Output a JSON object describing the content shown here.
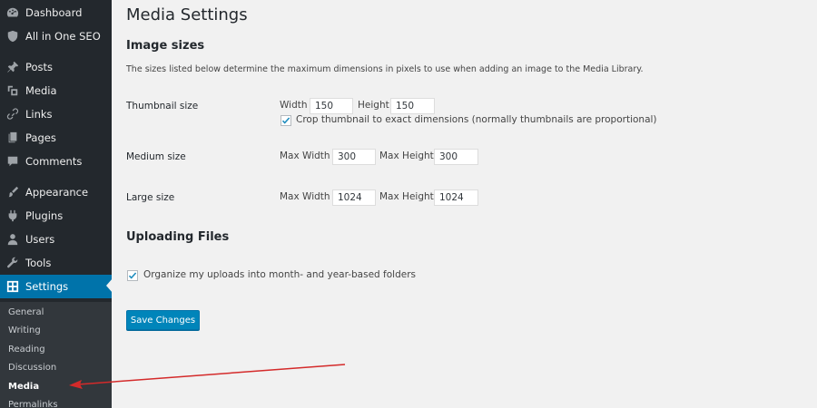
{
  "sidebar": {
    "menu": [
      {
        "label": "Dashboard",
        "icon": "dashboard-icon"
      },
      {
        "label": "All in One SEO",
        "icon": "shield-icon"
      },
      {
        "label": "Posts",
        "icon": "pushpin-icon"
      },
      {
        "label": "Media",
        "icon": "media-icon"
      },
      {
        "label": "Links",
        "icon": "link-icon"
      },
      {
        "label": "Pages",
        "icon": "pages-icon"
      },
      {
        "label": "Comments",
        "icon": "comment-icon"
      },
      {
        "label": "Appearance",
        "icon": "paintbrush-icon"
      },
      {
        "label": "Plugins",
        "icon": "plugin-icon"
      },
      {
        "label": "Users",
        "icon": "user-icon"
      },
      {
        "label": "Tools",
        "icon": "wrench-icon"
      },
      {
        "label": "Settings",
        "icon": "settings-icon"
      }
    ],
    "submenu": [
      "General",
      "Writing",
      "Reading",
      "Discussion",
      "Media",
      "Permalinks"
    ]
  },
  "main": {
    "title": "Media Settings",
    "image_sizes": {
      "heading": "Image sizes",
      "description": "The sizes listed below determine the maximum dimensions in pixels to use when adding an image to the Media Library.",
      "thumbnail": {
        "label": "Thumbnail size",
        "width_label": "Width",
        "width_value": "150",
        "height_label": "Height",
        "height_value": "150",
        "crop_label": "Crop thumbnail to exact dimensions (normally thumbnails are proportional)",
        "crop_checked": true
      },
      "medium": {
        "label": "Medium size",
        "width_label": "Max Width",
        "width_value": "300",
        "height_label": "Max Height",
        "height_value": "300"
      },
      "large": {
        "label": "Large size",
        "width_label": "Max Width",
        "width_value": "1024",
        "height_label": "Max Height",
        "height_value": "1024"
      }
    },
    "uploading": {
      "heading": "Uploading Files",
      "organize_label": "Organize my uploads into month- and year-based folders",
      "organize_checked": true
    },
    "save_label": "Save Changes"
  },
  "colors": {
    "sidebar_bg": "#23282d",
    "submenu_bg": "#32373c",
    "accent": "#0073aa",
    "button": "#0085ba",
    "annotation_arrow": "#d42a2a"
  }
}
